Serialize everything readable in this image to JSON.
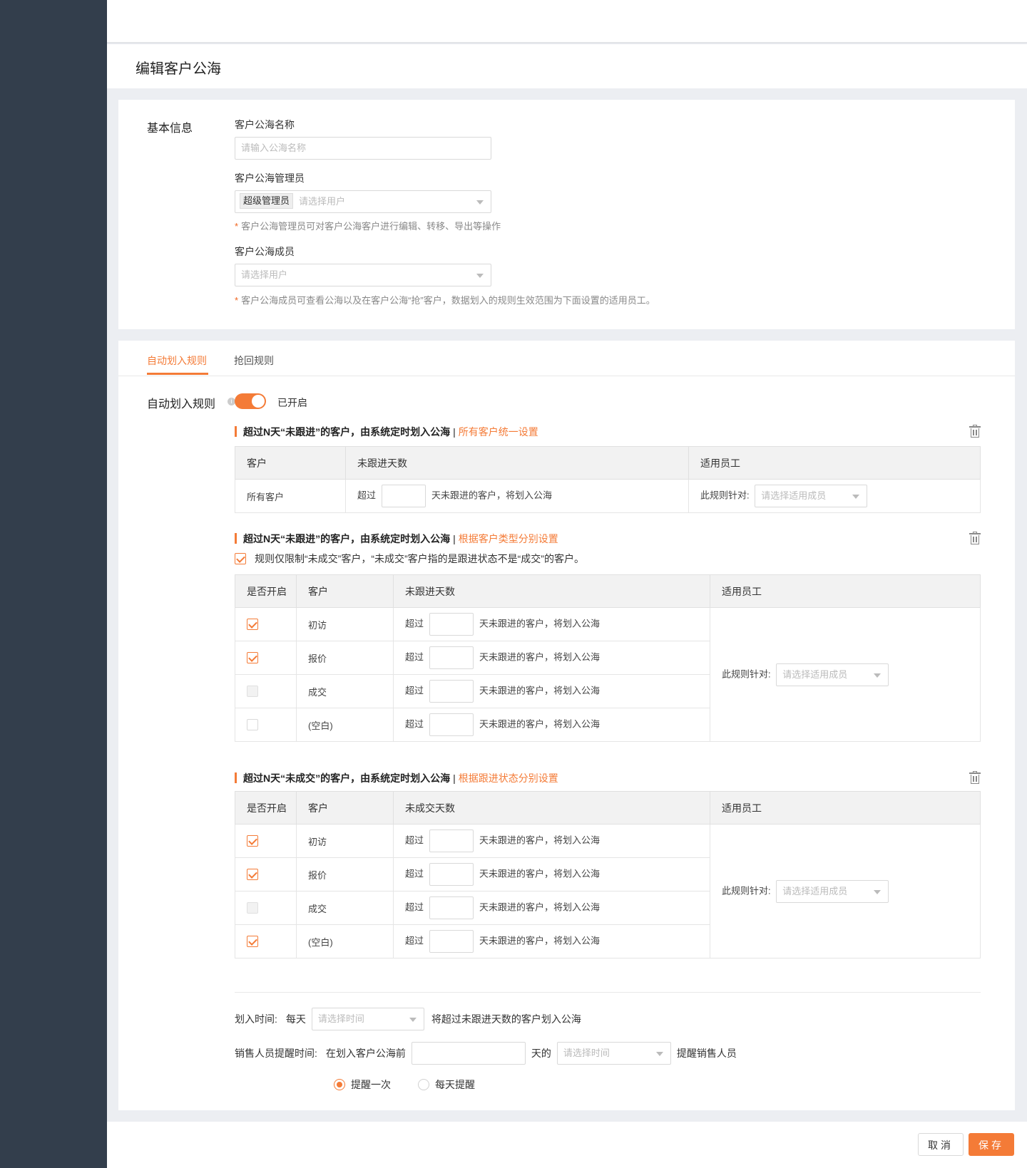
{
  "page_title": "编辑客户公海",
  "basic": {
    "section_label": "基本信息",
    "name_label": "客户公海名称",
    "name_placeholder": "请输入公海名称",
    "admin_label": "客户公海管理员",
    "admin_tag": "超级管理员",
    "admin_placeholder": "请选择用户",
    "admin_hint": "客户公海管理员可对客户公海客户进行编辑、转移、导出等操作",
    "member_label": "客户公海成员",
    "member_placeholder": "请选择用户",
    "member_hint": "客户公海成员可查看公海以及在客户公海“抢”客户，数据划入的规则生效范围为下面设置的适用员工。",
    "hint_star": "*"
  },
  "tabs": [
    {
      "label": "自动划入规则",
      "active": true
    },
    {
      "label": "抢回规则",
      "active": false
    }
  ],
  "auto_rule": {
    "label": "自动划入规则",
    "info_icon": "i",
    "toggle_on": true,
    "toggle_text": "已开启"
  },
  "rule1": {
    "title": "超过N天“未跟进”的客户，由系统定时划入公海",
    "sep": "|",
    "link": "所有客户统一设置",
    "headers": [
      "客户",
      "未跟进天数",
      "适用员工"
    ],
    "row": {
      "customer": "所有客户",
      "prefix": "超过",
      "suffix": "天未跟进的客户，将划入公海",
      "target_label": "此规则针对:",
      "target_placeholder": "请选择适用成员"
    }
  },
  "rule2": {
    "title": "超过N天“未跟进”的客户，由系统定时划入公海",
    "sep": "|",
    "link": "根据客户类型分别设置",
    "limit_checked": true,
    "limit_text": "规则仅限制“未成交”客户，“未成交”客户指的是跟进状态不是“成交”的客户。",
    "headers": [
      "是否开启",
      "客户",
      "未跟进天数",
      "适用员工"
    ],
    "rows": [
      {
        "enabled": "on",
        "customer": "初访",
        "prefix": "超过",
        "suffix": "天未跟进的客户，将划入公海"
      },
      {
        "enabled": "on",
        "customer": "报价",
        "prefix": "超过",
        "suffix": "天未跟进的客户，将划入公海"
      },
      {
        "enabled": "disabled",
        "customer": "成交",
        "prefix": "超过",
        "suffix": "天未跟进的客户，将划入公海"
      },
      {
        "enabled": "off",
        "customer": "(空白)",
        "prefix": "超过",
        "suffix": "天未跟进的客户，将划入公海"
      }
    ],
    "target_label": "此规则针对:",
    "target_placeholder": "请选择适用成员"
  },
  "rule3": {
    "title": "超过N天“未成交”的客户，由系统定时划入公海",
    "sep": "|",
    "link": "根据跟进状态分别设置",
    "headers": [
      "是否开启",
      "客户",
      "未成交天数",
      "适用员工"
    ],
    "rows": [
      {
        "enabled": "on",
        "customer": "初访",
        "prefix": "超过",
        "suffix": "天未跟进的客户，将划入公海"
      },
      {
        "enabled": "on",
        "customer": "报价",
        "prefix": "超过",
        "suffix": "天未跟进的客户，将划入公海"
      },
      {
        "enabled": "disabled",
        "customer": "成交",
        "prefix": "超过",
        "suffix": "天未跟进的客户，将划入公海"
      },
      {
        "enabled": "on",
        "customer": "(空白)",
        "prefix": "超过",
        "suffix": "天未跟进的客户，将划入公海"
      }
    ],
    "target_label": "此规则针对:",
    "target_placeholder": "请选择适用成员"
  },
  "schedule": {
    "time_label": "划入时间:",
    "every_day": "每天",
    "time_placeholder": "请选择时间",
    "time_suffix": "将超过未跟进天数的客户划入公海",
    "remind_label": "销售人员提醒时间:",
    "remind_prefix": "在划入客户公海前",
    "remind_days_value": "",
    "remind_mid": "天的",
    "remind_time_placeholder": "请选择时间",
    "remind_suffix": "提醒销售人员",
    "radio_once": "提醒一次",
    "radio_daily": "每天提醒",
    "selected": "once"
  },
  "footer": {
    "cancel": "取消",
    "save": "保存"
  },
  "colors": {
    "accent": "#f47b37",
    "sidebar": "#333e4c"
  }
}
